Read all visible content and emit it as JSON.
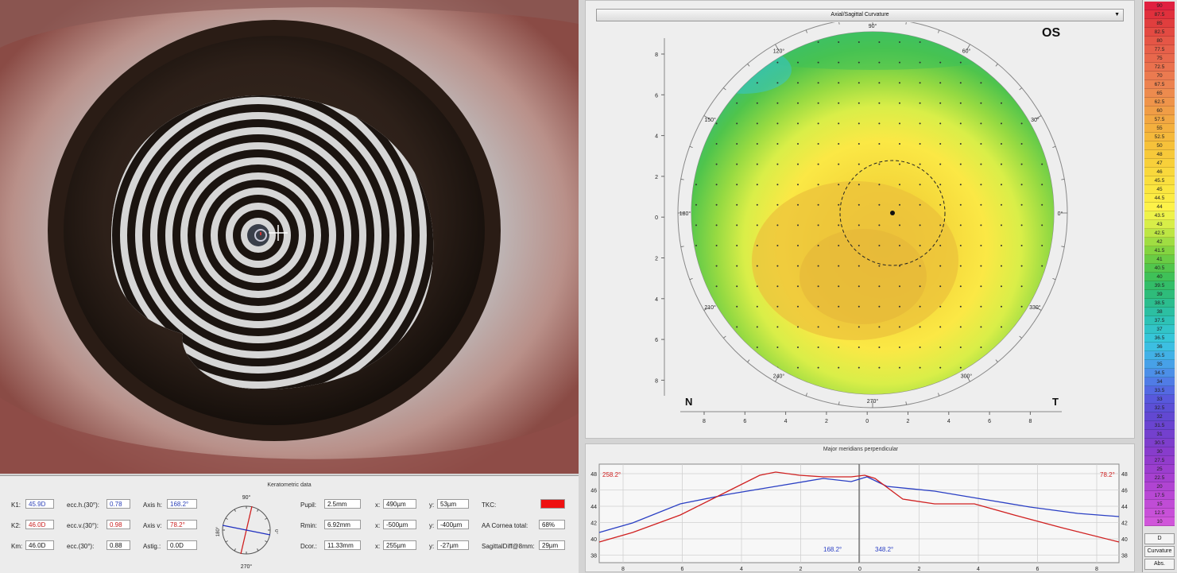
{
  "map": {
    "dropdown_label": "Axial/Sagittal Curvature",
    "eye_side": "OS",
    "nasal_label": "N",
    "temporal_label": "T",
    "angle_labels": [
      "90°",
      "60°",
      "30°",
      "0°",
      "330°",
      "300°",
      "270°",
      "240°",
      "210°",
      "180°",
      "150°",
      "120°"
    ],
    "y_ticks": [
      "8",
      "6",
      "4",
      "2",
      "0",
      "2",
      "4",
      "6",
      "8"
    ],
    "x_ticks": [
      "8",
      "6",
      "4",
      "2",
      "0",
      "2",
      "4",
      "6",
      "8"
    ]
  },
  "scale": {
    "values": [
      "90",
      "87.5",
      "85",
      "82.5",
      "80",
      "77.5",
      "75",
      "72.5",
      "70",
      "67.5",
      "65",
      "62.5",
      "60",
      "57.5",
      "55",
      "52.5",
      "50",
      "48",
      "47",
      "46",
      "45.5",
      "45",
      "44.5",
      "44",
      "43.5",
      "43",
      "42.5",
      "42",
      "41.5",
      "41",
      "40.5",
      "40",
      "39.5",
      "39",
      "38.5",
      "38",
      "37.5",
      "37",
      "36.5",
      "36",
      "35.5",
      "35",
      "34.5",
      "34",
      "33.5",
      "33",
      "32.5",
      "32",
      "31.5",
      "31",
      "30.5",
      "30",
      "27.5",
      "25",
      "22.5",
      "20",
      "17.5",
      "15",
      "12.5",
      "10"
    ],
    "colors": [
      "#e02040",
      "#e0303c",
      "#e03e3e",
      "#e34a42",
      "#e55646",
      "#e7604a",
      "#e8684c",
      "#ea714e",
      "#eb7a50",
      "#ec8250",
      "#ed8b4e",
      "#ef944a",
      "#f09d46",
      "#f2a742",
      "#f4b03e",
      "#f5b93c",
      "#f6c13a",
      "#f7c93a",
      "#f8d03a",
      "#f9d83c",
      "#fadf3e",
      "#fbe640",
      "#fcec44",
      "#fdf249",
      "#eef24a",
      "#d8ee48",
      "#bde644",
      "#a0dd42",
      "#84d440",
      "#6acc44",
      "#52c64c",
      "#3fc158",
      "#33bd68",
      "#2ebc7a",
      "#2cbd8e",
      "#2cbfa2",
      "#2ec2b6",
      "#32c4c8",
      "#36c6d8",
      "#3cbfe2",
      "#42b1e6",
      "#47a1e8",
      "#4c8fe8",
      "#507ce6",
      "#5469e2",
      "#5858dc",
      "#5c4fd6",
      "#6248d2",
      "#6a44d0",
      "#7440ce",
      "#7e3ecc",
      "#883ccc",
      "#923ccc",
      "#9c3ece",
      "#a640d0",
      "#b044d2",
      "#b848d4",
      "#c04cd6",
      "#c850d8",
      "#d056da"
    ],
    "btn_d": "D",
    "btn_curvature": "Curvature",
    "btn_abs": "Abs."
  },
  "kerato": {
    "title": "Keratometric data",
    "k1_label": "K1:",
    "k1_value": "45.9D",
    "k2_label": "K2:",
    "k2_value": "46.0D",
    "km_label": "Km:",
    "km_value": "46.0D",
    "ecch_label": "ecc.h.(30°):",
    "ecch_value": "0.78",
    "eccv_label": "ecc.v.(30°):",
    "eccv_value": "0.98",
    "ecc_label": "ecc.(30°):",
    "ecc_value": "0.88",
    "axish_label": "Axis h:",
    "axish_value": "168.2°",
    "axisv_label": "Axis v:",
    "axisv_value": "78.2°",
    "astig_label": "Astig.:",
    "astig_value": "0.0D",
    "dial_top": "90°",
    "dial_bottom": "270°",
    "dial_left": "180°",
    "dial_right": "0°",
    "pupil_label": "Pupil:",
    "pupil_value": "2.5mm",
    "pupil_x_label": "x:",
    "pupil_x": "490µm",
    "pupil_y_label": "y:",
    "pupil_y": "53µm",
    "rmin_label": "Rmin:",
    "rmin_value": "6.92mm",
    "rmin_x_label": "x:",
    "rmin_x": "-500µm",
    "rmin_y_label": "y:",
    "rmin_y": "-400µm",
    "dcor_label": "Dcor.:",
    "dcor_value": "11.33mm",
    "dcor_x_label": "x:",
    "dcor_x": "255µm",
    "dcor_y_label": "y:",
    "dcor_y": "-27µm",
    "tkc_label": "TKC:",
    "tkc_color": "#ee1111",
    "aa_label": "AA Cornea total:",
    "aa_value": "68%",
    "sag_label": "SagittalDiff@8mm:",
    "sag_value": "29µm"
  },
  "meridian": {
    "title": "Major meridians perpendicular",
    "red_axis_label": "258.2°",
    "red_axis_label_right": "78.2°",
    "blue_axis_label": "168.2°",
    "blue_axis_label_right": "348.2°",
    "y_ticks": [
      "48",
      "46",
      "44",
      "42",
      "40",
      "38"
    ],
    "x_ticks": [
      "8",
      "6",
      "4",
      "2",
      "0",
      "2",
      "4",
      "6",
      "8"
    ]
  }
}
